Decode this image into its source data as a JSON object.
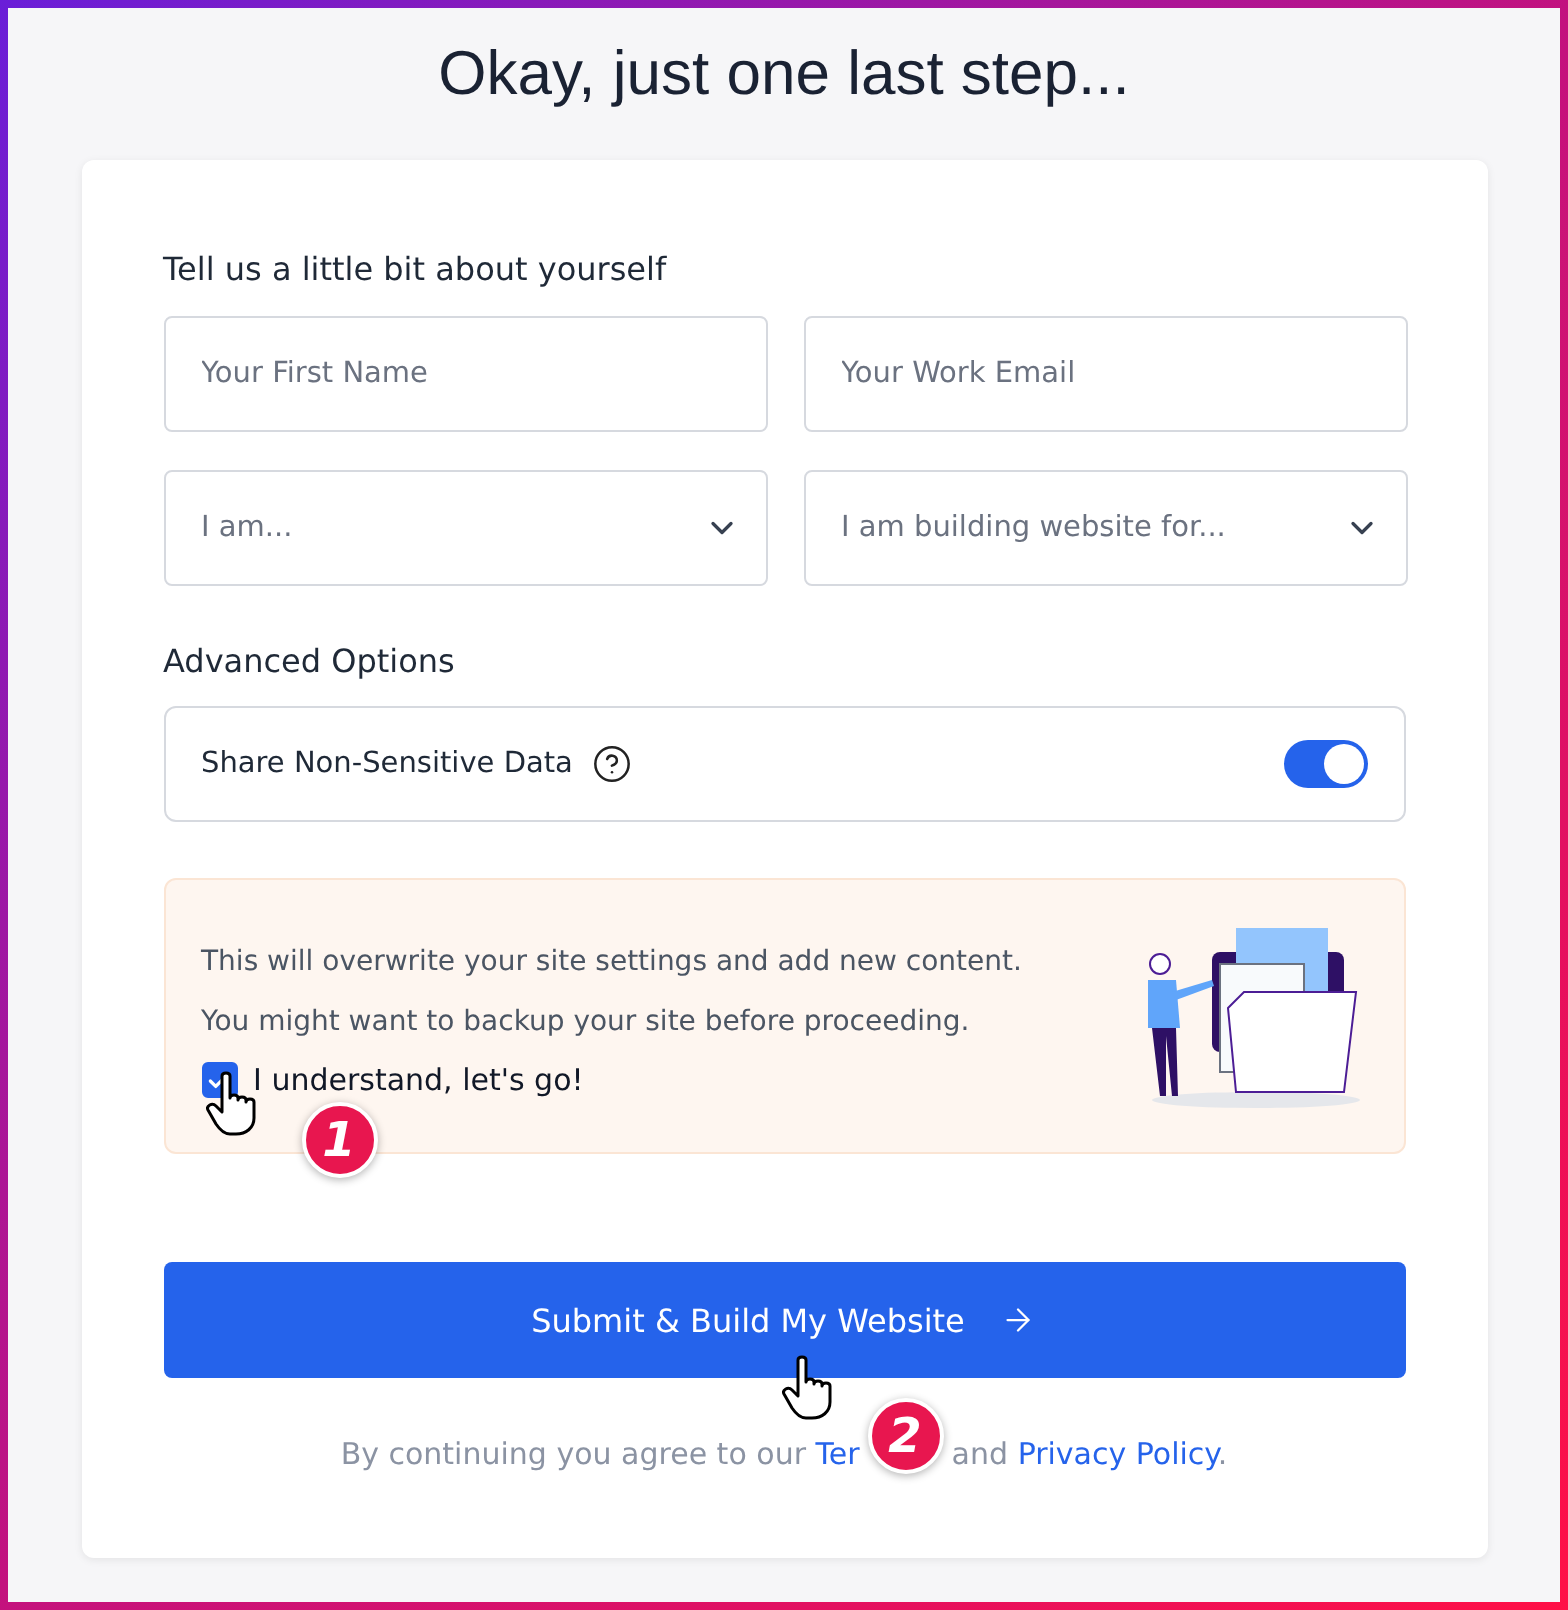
{
  "title": "Okay, just one last step...",
  "section_label": "Tell us a little bit about yourself",
  "fields": [
    {
      "kind": "text",
      "placeholder": "Your First Name"
    },
    {
      "kind": "text",
      "placeholder": "Your Work Email"
    },
    {
      "kind": "select",
      "placeholder": "I am..."
    },
    {
      "kind": "select",
      "placeholder": "I am building website for..."
    }
  ],
  "advanced": {
    "label": "Advanced Options",
    "option": {
      "label": "Share Non-Sensitive Data",
      "on": true
    }
  },
  "notice": {
    "lines": [
      "This will overwrite your site settings and add new content.",
      "You might want to backup your site before proceeding."
    ],
    "checkbox": {
      "label": "I understand, let's go!",
      "checked": true
    }
  },
  "submit": {
    "label": "Submit & Build My Website"
  },
  "footer": {
    "text": "By continuing you agree to our",
    "terms": "Ter",
    "and": "and",
    "privacy": "Privacy Policy",
    "end": "."
  },
  "annotations": [
    "1",
    "2"
  ]
}
